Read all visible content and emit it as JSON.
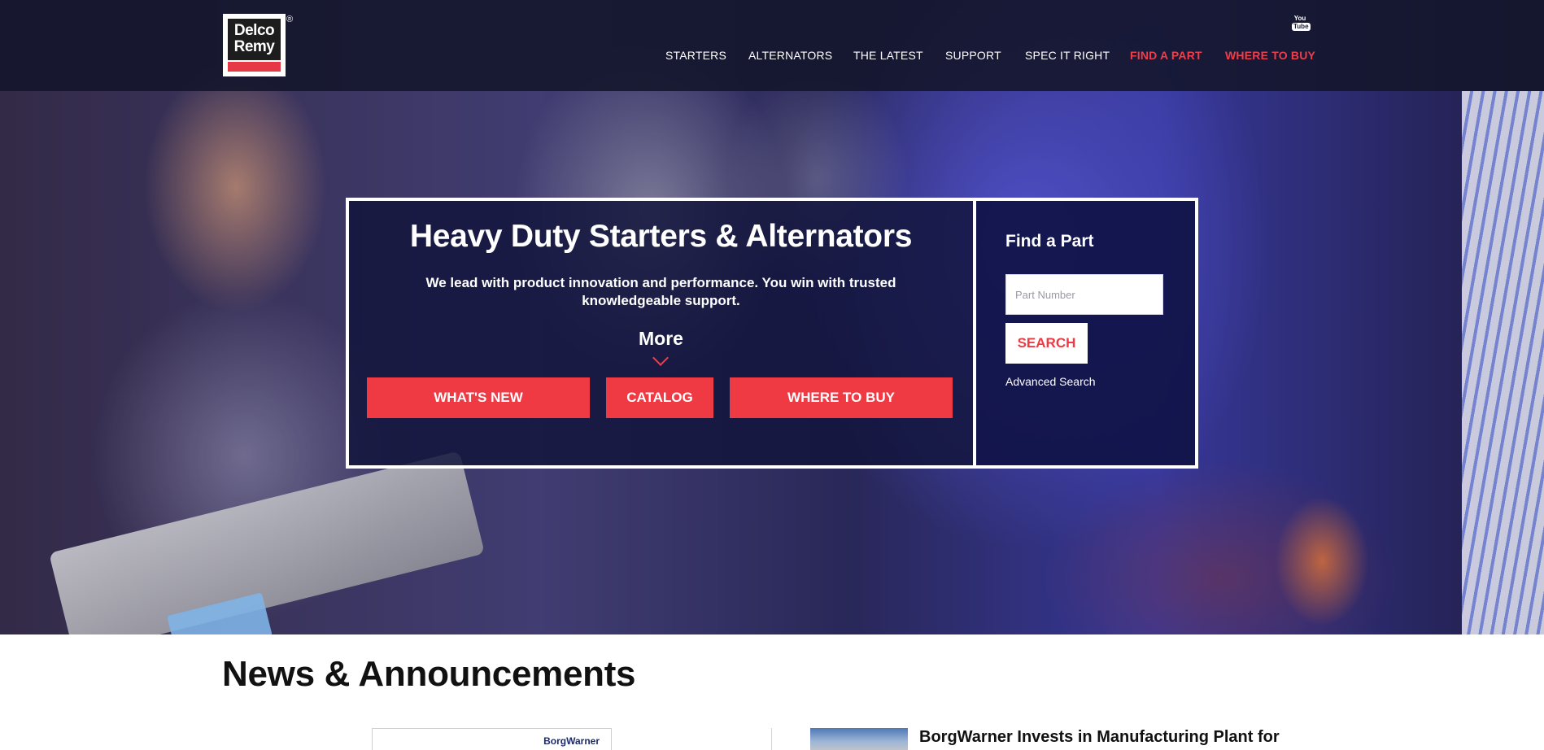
{
  "header": {
    "logo_text_line1": "Delco",
    "logo_text_line2": "Remy",
    "logo_mark": "®",
    "nav": [
      {
        "label": "STARTERS"
      },
      {
        "label": "ALTERNATORS"
      },
      {
        "label": "THE LATEST"
      },
      {
        "label": "SUPPORT"
      },
      {
        "label": "SPEC IT RIGHT"
      },
      {
        "label": "FIND A PART"
      },
      {
        "label": "WHERE TO BUY"
      }
    ],
    "social": {
      "icon": "youtube-icon",
      "line1": "You",
      "line2": "Tube"
    }
  },
  "hero": {
    "title": "Heavy Duty Starters & Alternators",
    "subtitle": "We lead with product innovation and performance. You win with trusted knowledgeable support.",
    "more_label": "More",
    "buttons": {
      "whats_new": "WHAT'S NEW",
      "catalog": "CATALOG",
      "where_to_buy": "WHERE TO BUY"
    }
  },
  "find_part": {
    "title": "Find a Part",
    "placeholder": "Part Number",
    "search_label": "SEARCH",
    "advanced_link": "Advanced Search"
  },
  "news": {
    "title": "News & Announcements",
    "card_brand": "BorgWarner",
    "headline": "BorgWarner Invests in Manufacturing Plant for"
  },
  "colors": {
    "accent_red": "#ef3a44",
    "header_bg": "#14162c",
    "panel_bg": "#12143c"
  }
}
